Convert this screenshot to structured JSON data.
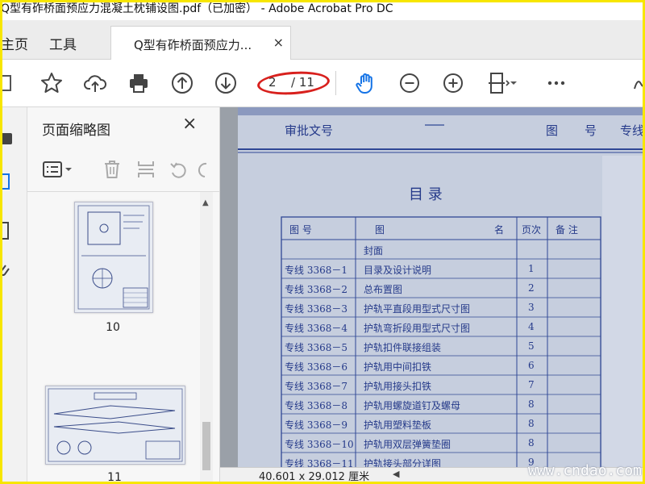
{
  "window": {
    "title": "Q型有砟桥面预应力混凝土枕铺设图.pdf（已加密） - Adobe Acrobat Pro DC"
  },
  "tabs": {
    "home": "主页",
    "tools": "工具",
    "document": "Q型有砟桥面预应力...",
    "close": "×"
  },
  "toolbar": {
    "current_page": "2",
    "total_pages": "/ 11"
  },
  "panel": {
    "title": "页面缩略图",
    "close": "×",
    "thumbnails": [
      {
        "number": "10"
      },
      {
        "number": "11"
      }
    ]
  },
  "document": {
    "header_left": "审批文号",
    "header_mid": "图",
    "header_mid2": "号",
    "header_right": "专线",
    "toc_title": "目  录",
    "columns": [
      "图     号",
      "图",
      "名",
      "页次",
      "备  注"
    ],
    "rows": [
      {
        "code": "",
        "name": "封面",
        "page": ""
      },
      {
        "code": "专线 3368－1",
        "name": "目录及设计说明",
        "page": "1"
      },
      {
        "code": "专线 3368－2",
        "name": "总布置图",
        "page": "2"
      },
      {
        "code": "专线 3368－3",
        "name": "护轨平直段用型式尺寸图",
        "page": "3"
      },
      {
        "code": "专线 3368－4",
        "name": "护轨弯折段用型式尺寸图",
        "page": "4"
      },
      {
        "code": "专线 3368－5",
        "name": "护轨扣件联接组装",
        "page": "5"
      },
      {
        "code": "专线 3368－6",
        "name": "护轨用中间扣铁",
        "page": "6"
      },
      {
        "code": "专线 3368－7",
        "name": "护轨用接头扣铁",
        "page": "7"
      },
      {
        "code": "专线 3368－8",
        "name": "护轨用螺旋道钉及螺母",
        "page": "8"
      },
      {
        "code": "专线 3368－9",
        "name": "护轨用塑料垫板",
        "page": "8"
      },
      {
        "code": "专线 3368－10",
        "name": "护轨用双层弹簧垫圈",
        "page": "8"
      },
      {
        "code": "专线 3368－11",
        "name": "护轨接头部分详图",
        "page": "9"
      }
    ],
    "page_size": "40.601 x 29.012 厘米",
    "watermark": "www.cndao.com"
  },
  "colors": {
    "annotation": "#d8201d",
    "accent": "#1473e6",
    "frame": "#f7e600"
  }
}
